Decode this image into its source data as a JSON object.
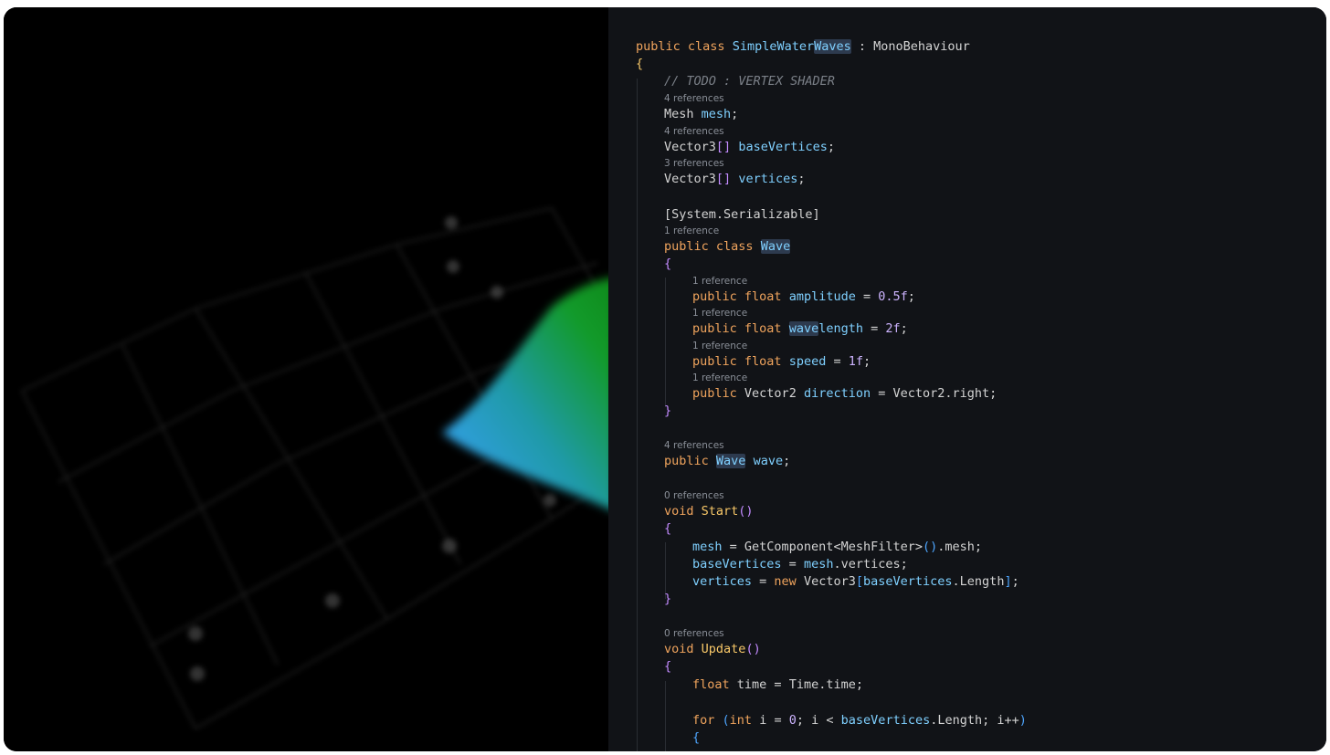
{
  "editor": {
    "refs": {
      "r4": "4 references",
      "r3": "3 references",
      "r1": "1 reference",
      "r0": "0 references"
    },
    "tokens": {
      "public": "public",
      "class": "class",
      "float": "float",
      "void": "void",
      "new": "new",
      "for": "for",
      "int": "int",
      "class_name": "SimpleWater",
      "class_name_hl": "Waves",
      "colon": " : ",
      "base": "MonoBehaviour",
      "brace_open": "{",
      "brace_close": "}",
      "comment": "// TODO : VERTEX SHADER",
      "mesh_type": "Mesh ",
      "mesh_var": "mesh",
      "semi": ";",
      "vec3": "Vector3",
      "arr": "[]",
      "base_vertices": "baseVertices",
      "vertices": "vertices",
      "serializable": "[System.Serializable]",
      "wave": "Wave",
      "wave_hl": "wave",
      "wave_rest": "length",
      "amplitude": "amplitude",
      "amp_val": "0.5f",
      "len_val": "2f",
      "speed": "speed",
      "speed_val": "1f",
      "vec2": "Vector2 ",
      "direction": "direction",
      "vec2_right": "Vector2.right",
      "eq": " = ",
      "wave_var": "wave",
      "start": "Start",
      "update": "Update",
      "parens": "()",
      "getcomp": "GetComponent<MeshFilter>",
      "dot_mesh": ".mesh",
      "mesh_vertices": "mesh",
      "dot_vertices": ".vertices",
      "bracket_open": "[",
      "bracket_close": "]",
      "length": ".Length",
      "time": "time",
      "time_val": "Time.time",
      "paren_open": "(",
      "paren_close": ")",
      "i": "i",
      "zero": "0",
      "lt": " < ",
      "i_inc": "i++",
      "semi_sp": "; "
    }
  },
  "colors": {
    "editor_bg": "#111317",
    "keyword": "#f0a45d",
    "type": "#7fd0ff",
    "function": "#f7c768",
    "number": "#cdb4ff",
    "comment": "#7b8088"
  }
}
